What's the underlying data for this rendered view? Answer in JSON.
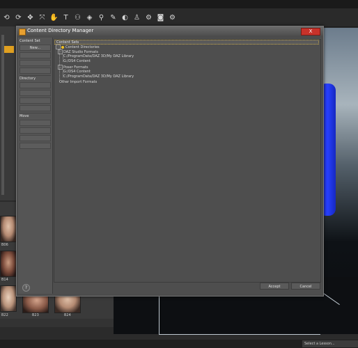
{
  "dialog": {
    "title": "Content Directory Manager",
    "close_label": "X",
    "help_label": "?",
    "accept_label": "Accept",
    "cancel_label": "Cancel"
  },
  "sidebar": {
    "content_set_header": "Content Set",
    "content_set_buttons": [
      "New..."
    ],
    "directory_header": "Directory",
    "move_header": "Move"
  },
  "tree": {
    "header": "Content Sets",
    "root": "Content Directories",
    "daz_formats": "DAZ Studio Formats",
    "daz_path1": "C:/ProgramData/DAZ 3D/My DAZ Library",
    "daz_path2": "G:/DS4 Content",
    "poser_formats": "Poser Formats",
    "poser_path1": "G:/DS4 Content",
    "poser_path2": "C:/ProgramData/DAZ 3D/My DAZ Library",
    "other_formats": "Other Import Formats"
  },
  "thumbnails": {
    "labels": [
      "B06",
      "B14",
      "B22",
      "B23",
      "B24"
    ]
  },
  "status_bar": {
    "lesson_select": "Select a Lesson..."
  },
  "colors": {
    "accent": "#e0a020",
    "close": "#c8322a",
    "figure": "#2840ff"
  }
}
